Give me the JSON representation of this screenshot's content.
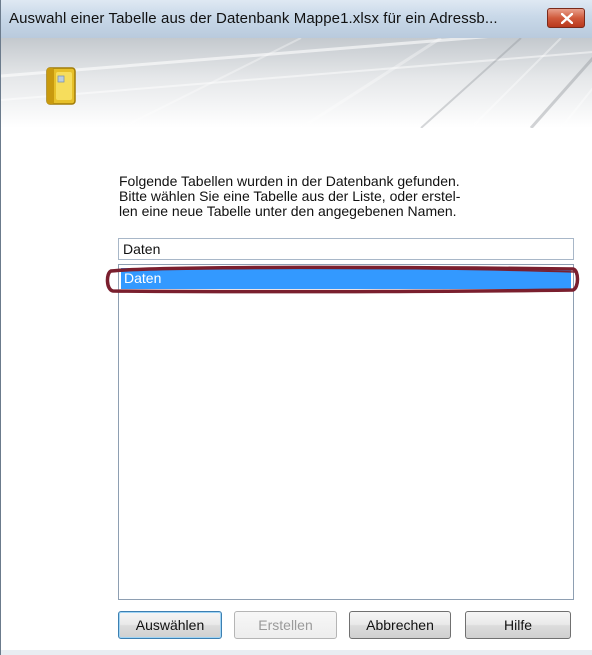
{
  "window": {
    "title": "Auswahl einer Tabelle aus der Datenbank Mappe1.xlsx für ein Adressb...",
    "close_icon": "close-icon"
  },
  "header": {
    "icon": "address-book-icon"
  },
  "intro": {
    "lines": [
      "Folgende Tabellen wurden in der Datenbank gefunden.",
      "Bitte wählen Sie eine Tabelle aus der Liste, oder erstel-",
      "len eine neue Tabelle unter den angegebenen Namen."
    ]
  },
  "name_input": {
    "value": "Daten"
  },
  "table_list": {
    "items": [
      "Daten"
    ],
    "selected_index": 0
  },
  "buttons": {
    "select": "Auswählen",
    "create": "Erstellen",
    "cancel": "Abbrechen",
    "help": "Hilfe"
  },
  "colors": {
    "selection": "#3399ff",
    "highlight_ring": "#7a1f2e",
    "close_button": "#c8462a"
  }
}
